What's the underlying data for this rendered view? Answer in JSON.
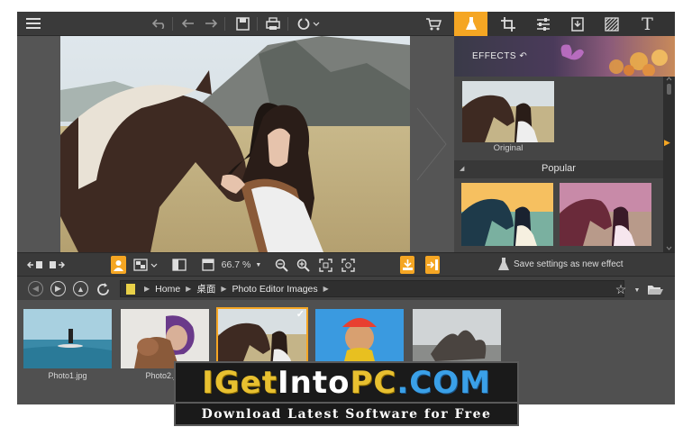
{
  "topbar": {
    "menu_icon": "hamburger-menu-icon",
    "icons": [
      "undo-icon",
      "undo-icon",
      "redo-icon",
      "save-icon",
      "print-icon",
      "share-icon",
      "cart-icon"
    ]
  },
  "tooltabs": {
    "items": [
      {
        "icon": "effects-flask-icon",
        "active": true
      },
      {
        "icon": "crop-icon",
        "active": false
      },
      {
        "icon": "adjust-sliders-icon",
        "active": false
      },
      {
        "icon": "retouch-icon",
        "active": false
      },
      {
        "icon": "texture-icon",
        "active": false
      },
      {
        "icon": "text-icon",
        "glyph": "T",
        "active": false
      }
    ],
    "accent": "#f5a623"
  },
  "effects": {
    "label": "EFFECTS",
    "original_label": "Original",
    "popular_label": "Popular"
  },
  "canvas_toolbar": {
    "zoom": "66.7 %",
    "save_effect": "Save settings as new effect"
  },
  "browser": {
    "crumbs": [
      "Home",
      "桌面",
      "Photo Editor Images"
    ]
  },
  "filmstrip": {
    "items": [
      {
        "label": "Photo1.jpg",
        "selected": false
      },
      {
        "label": "Photo2.jpg",
        "selected": false
      },
      {
        "label": "",
        "selected": true
      },
      {
        "label": "",
        "selected": false
      },
      {
        "label": "",
        "selected": false
      }
    ]
  },
  "watermark": {
    "part1": "I",
    "part2": "Get",
    "part3": "Into",
    "part4": "PC",
    "part5": ".COM",
    "tagline": "Download Latest Software for Free"
  }
}
